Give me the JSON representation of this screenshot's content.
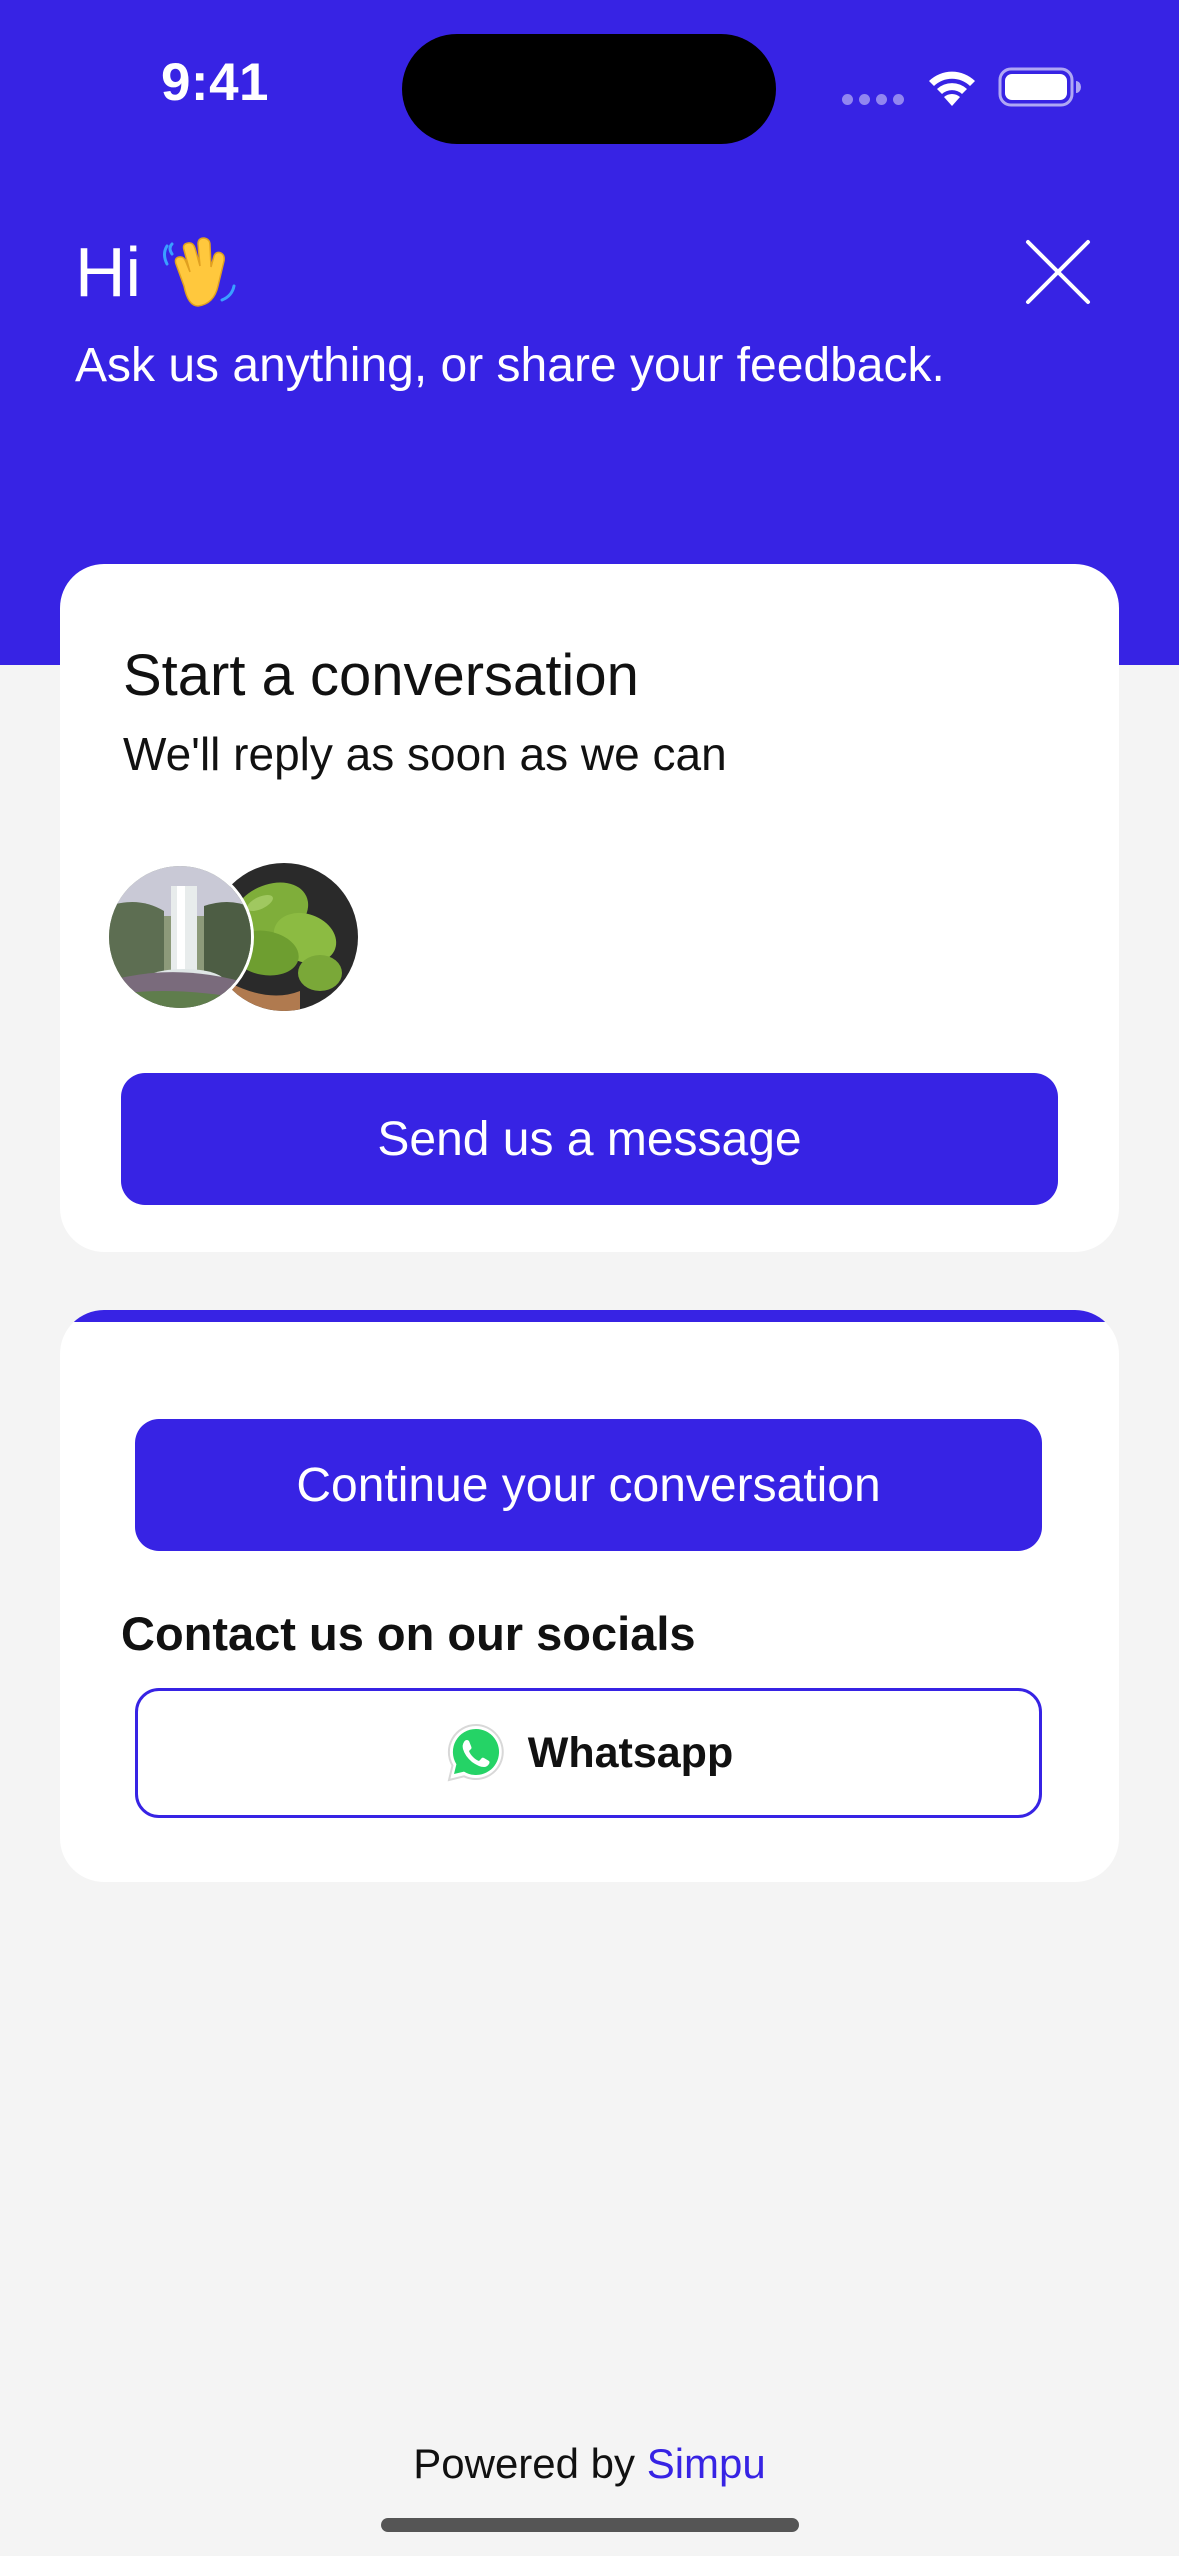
{
  "status_bar": {
    "time": "9:41"
  },
  "header": {
    "greeting": "Hi",
    "wave_icon": "waving-hand-icon",
    "subtitle": "Ask us anything, or share your feedback.",
    "close_icon": "close-icon"
  },
  "start_card": {
    "title": "Start a conversation",
    "subtitle": "We'll reply as soon as we can",
    "avatars": [
      "waterfall-avatar",
      "green-fruit-avatar"
    ],
    "button_label": "Send us a message"
  },
  "contact_card": {
    "continue_label": "Continue your conversation",
    "socials_title": "Contact us on our socials",
    "whatsapp_label": "Whatsapp",
    "whatsapp_icon": "whatsapp-icon"
  },
  "footer": {
    "powered_prefix": "Powered by",
    "brand": "Simpu"
  },
  "colors": {
    "brand": "#3723e4",
    "background": "#f4f4f4",
    "card": "#ffffff",
    "whatsapp": "#25d366"
  }
}
